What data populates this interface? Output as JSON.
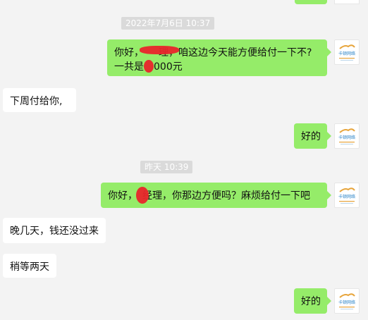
{
  "chat": {
    "timestamps": [
      "2022年7月6日 10:37",
      "昨天 10:39"
    ],
    "messages": {
      "m1_line1": "你好，　　理，咱这边今天能方便给付一下不?",
      "m1_line2": "一共是　000元",
      "m2": "下周付给你,",
      "m3": "好的",
      "m4": "你好，　经理，你那边方便吗？麻烦给付一下吧",
      "m5": "晚几天，钱还没过来",
      "m6": "稍等两天",
      "m7": "好的"
    },
    "avatar": {
      "logo_text": "卡顿网络",
      "icon": "company-logo-icon"
    }
  },
  "colors": {
    "background": "#f3f3f3",
    "sent_bubble": "#95ec69",
    "received_bubble": "#ffffff",
    "timestamp_bg": "#dadada",
    "redaction": "#e8262b"
  }
}
